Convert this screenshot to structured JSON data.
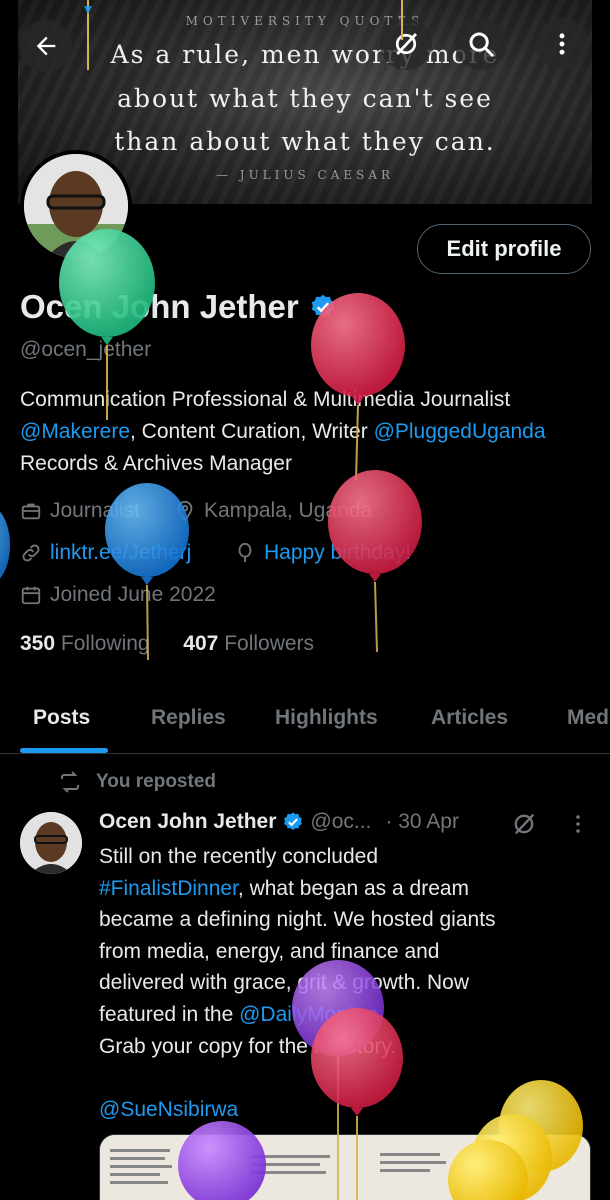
{
  "banner": {
    "brand": "MOTIVERSITY QUOTES",
    "quote_lines": [
      "As a rule, men worry more",
      "about what they can't see",
      "than about what they can."
    ],
    "author": "— JULIUS CAESAR"
  },
  "top_bar": {
    "back_icon": "arrow-left-icon",
    "grok_icon": "grok-icon",
    "search_icon": "search-icon",
    "more_icon": "more-vertical-icon"
  },
  "profile": {
    "edit_label": "Edit profile",
    "name": "Ocen John Jether",
    "handle": "@ocen_jether",
    "bio": {
      "part1": "Communication Professional & Multimedia Journalist ",
      "mention1": "@Makerere",
      "part2": ", Content Curation, Writer ",
      "mention2": "@PluggedUganda",
      "part3": " Records & Archives Manager"
    },
    "profession": "Journalist",
    "location": "Kampala, Uganda",
    "website": "linktr.ee/Jetherj",
    "birthday": "Happy birthday!",
    "joined": "Joined June 2022",
    "following_count": "350",
    "following_label": "Following",
    "followers_count": "407",
    "followers_label": "Followers"
  },
  "tabs": [
    "Posts",
    "Replies",
    "Highlights",
    "Articles",
    "Media"
  ],
  "tabs_visible": [
    "Posts",
    "Replies",
    "Highlights",
    "Articles",
    "Med"
  ],
  "post": {
    "repost_label": "You reposted",
    "author_name": "Ocen John Jether",
    "author_handle": "@oc...",
    "time": "· 30 Apr",
    "lines": {
      "l1": "Still on the recently concluded",
      "hashtag": "#FinalistDinner",
      "l2": ", what began as a dream",
      "l3": "became a defining night. We hosted giants",
      "l4": "from media, energy, and finance and",
      "l5": "delivered with grace, grit & growth. Now",
      "l6a": "featured in the ",
      "mention": "@DailyMonitor",
      "l7": "Grab your copy for the full story.",
      "mention2": "@SueNsibirwa"
    }
  },
  "colors": {
    "accent": "#1d9bf0",
    "muted": "#71767b",
    "text": "#e7e9ea",
    "background": "#000000"
  }
}
